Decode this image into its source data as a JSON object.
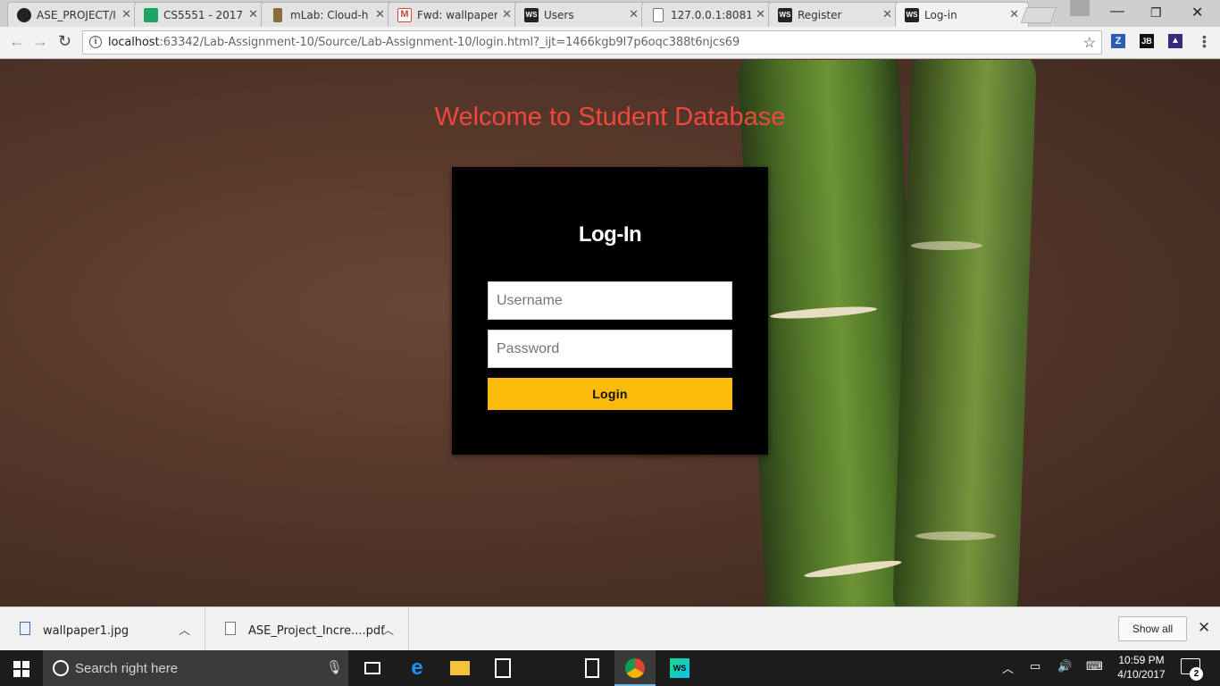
{
  "browser": {
    "tabs": [
      {
        "label": "ASE_PROJECT/I",
        "icon": "github-icon"
      },
      {
        "label": "CS5551 - 2017",
        "icon": "sheets-icon"
      },
      {
        "label": "mLab: Cloud-h",
        "icon": "mlab-icon"
      },
      {
        "label": "Fwd: wallpaper",
        "icon": "gmail-icon"
      },
      {
        "label": "Users",
        "icon": "webstorm-icon"
      },
      {
        "label": "127.0.0.1:8081/",
        "icon": "page-icon"
      },
      {
        "label": "Register",
        "icon": "webstorm-icon"
      },
      {
        "label": "Log-in",
        "icon": "webstorm-icon"
      }
    ],
    "url_host": "localhost",
    "url_rest": ":63342/Lab-Assignment-10/Source/Lab-Assignment-10/login.html?_ijt=1466kgb9l7p6oqc388t6njcs69",
    "extensions": [
      "Z",
      "JB",
      "▲"
    ]
  },
  "page": {
    "heading": "Welcome to Student Database",
    "login_title": "Log-In",
    "username_placeholder": "Username",
    "password_placeholder": "Password",
    "login_button": "Login"
  },
  "downloads": {
    "items": [
      "wallpaper1.jpg",
      "ASE_Project_Incre....pdf"
    ],
    "show_all": "Show all"
  },
  "taskbar": {
    "search_text": "Search right here",
    "time": "10:59 PM",
    "date": "4/10/2017",
    "notifications": "2"
  },
  "colors": {
    "heading": "#f2473f",
    "login_button": "#fbbb0b",
    "login_box": "#000000"
  }
}
